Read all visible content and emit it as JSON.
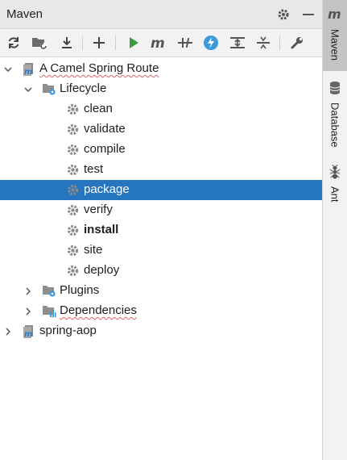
{
  "header": {
    "title": "Maven"
  },
  "tree": [
    {
      "label": "A Camel Spring Route",
      "level": 0,
      "expanded": true,
      "type": "project",
      "squiggle": true
    },
    {
      "label": "Lifecycle",
      "level": 1,
      "expanded": true,
      "type": "folder-gear"
    },
    {
      "label": "clean",
      "level": 2,
      "type": "goal"
    },
    {
      "label": "validate",
      "level": 2,
      "type": "goal"
    },
    {
      "label": "compile",
      "level": 2,
      "type": "goal"
    },
    {
      "label": "test",
      "level": 2,
      "type": "goal"
    },
    {
      "label": "package",
      "level": 2,
      "type": "goal",
      "selected": true
    },
    {
      "label": "verify",
      "level": 2,
      "type": "goal"
    },
    {
      "label": "install",
      "level": 2,
      "type": "goal",
      "bold": true
    },
    {
      "label": "site",
      "level": 2,
      "type": "goal"
    },
    {
      "label": "deploy",
      "level": 2,
      "type": "goal"
    },
    {
      "label": "Plugins",
      "level": 1,
      "expanded": false,
      "type": "folder-gear"
    },
    {
      "label": "Dependencies",
      "level": 1,
      "expanded": false,
      "type": "folder-deps",
      "squiggle": true
    },
    {
      "label": "spring-aop",
      "level": 0,
      "expanded": false,
      "type": "project"
    }
  ],
  "sidebar": {
    "tabs": [
      {
        "label": "Maven",
        "icon": "maven-m-icon",
        "active": true
      },
      {
        "label": "Database",
        "icon": "database-icon",
        "active": false
      },
      {
        "label": "Ant",
        "icon": "ant-icon",
        "active": false
      }
    ]
  },
  "colors": {
    "selection": "#2675bf",
    "accent_blue": "#3a9bd8",
    "run_green": "#3c9a3c"
  }
}
